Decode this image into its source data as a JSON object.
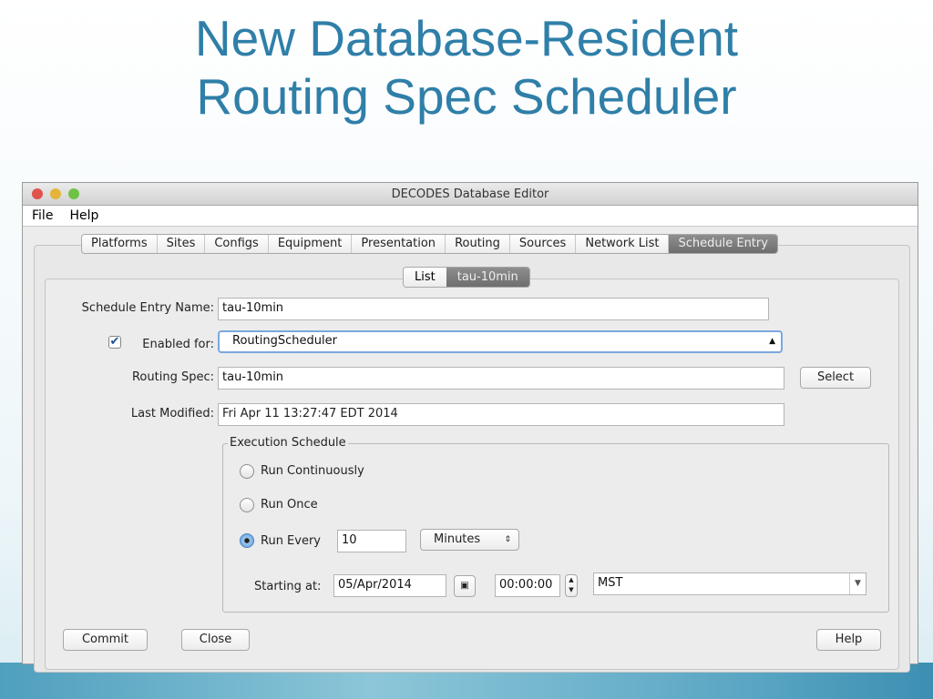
{
  "slide": {
    "title_line1": "New Database-Resident",
    "title_line2": "Routing Spec Scheduler"
  },
  "window": {
    "title": "DECODES Database Editor"
  },
  "menu": [
    "File",
    "Help"
  ],
  "tabs": [
    "Platforms",
    "Sites",
    "Configs",
    "Equipment",
    "Presentation",
    "Routing",
    "Sources",
    "Network List",
    "Schedule Entry"
  ],
  "subtabs": [
    "List",
    "tau-10min"
  ],
  "form": {
    "name_label": "Schedule Entry Name:",
    "name_value": "tau-10min",
    "enabled_label": "Enabled for:",
    "enabled_checked": true,
    "enabled_value": "RoutingScheduler",
    "routing_label": "Routing Spec:",
    "routing_value": "tau-10min",
    "select_button": "Select",
    "modified_label": "Last Modified:",
    "modified_value": "Fri Apr 11 13:27:47 EDT 2014"
  },
  "schedule": {
    "group_label": "Execution Schedule",
    "run_continuously": "Run Continuously",
    "run_once": "Run Once",
    "run_every": "Run Every",
    "interval_value": "10",
    "interval_unit": "Minutes",
    "starting_label": "Starting at:",
    "start_date": "05/Apr/2014",
    "start_time": "00:00:00",
    "timezone": "MST"
  },
  "buttons": {
    "commit": "Commit",
    "close": "Close",
    "help": "Help"
  }
}
